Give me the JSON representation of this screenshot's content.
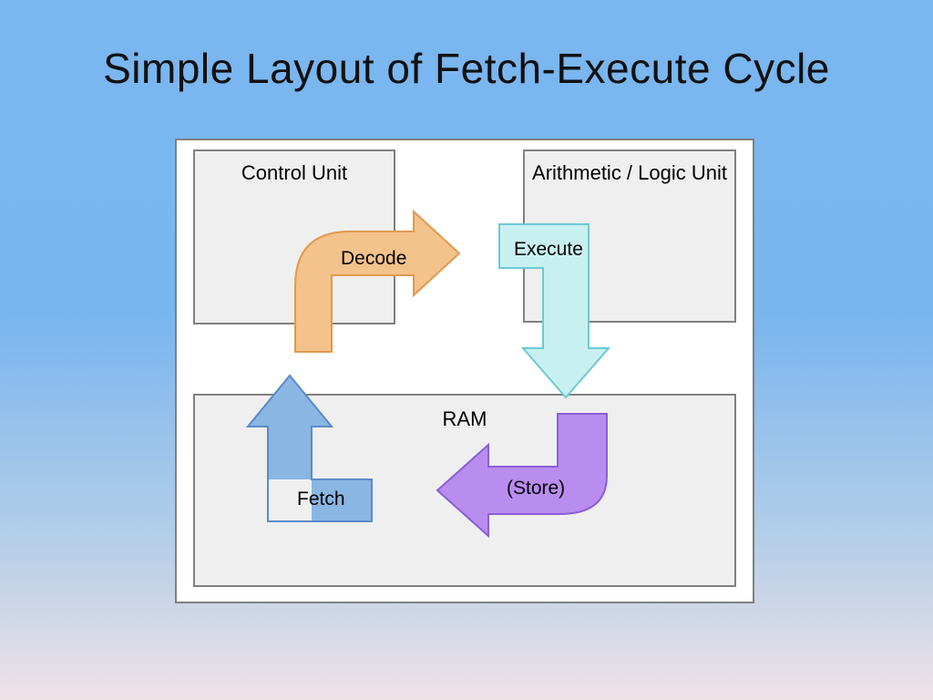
{
  "title": "Simple Layout of Fetch-Execute Cycle",
  "boxes": {
    "control_unit": "Control Unit",
    "alu": "Arithmetic / Logic Unit",
    "ram": "RAM"
  },
  "stages": {
    "decode": "Decode",
    "execute": "Execute",
    "store": "(Store)",
    "fetch": "Fetch"
  },
  "colors": {
    "decode_fill": "#f4c28b",
    "decode_stroke": "#e09a4f",
    "execute_fill": "#c9f0f0",
    "execute_stroke": "#6cc9d4",
    "store_fill": "#b98df0",
    "store_stroke": "#8a5ed6",
    "fetch_fill": "#8ab6e3",
    "fetch_stroke": "#5a8bc7",
    "box_fill": "#efefef",
    "box_stroke": "#808080"
  }
}
